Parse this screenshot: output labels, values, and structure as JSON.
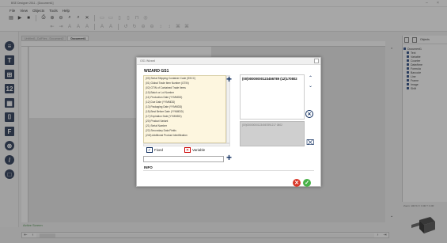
{
  "window": {
    "title": "BSE Designer 2011 - [Document1]"
  },
  "menu": {
    "items": [
      "File",
      "View",
      "Objects",
      "Tools",
      "Help"
    ]
  },
  "tabs": [
    {
      "label": "Untitled1_CalFiles - Document2",
      "active": false
    },
    {
      "label": "Document1",
      "active": true
    }
  ],
  "status": {
    "active_layer": "Active Screen",
    "zoom_line": "Zoom: 100 %      X: 0.00 Y: 0.00"
  },
  "objects_panel": {
    "title": "Objects",
    "tree": [
      "Document1",
      "Text",
      "Variable",
      "Counter",
      "Date/time",
      "Formula",
      "Barcode",
      "Line",
      "Frame",
      "Image",
      "Shift"
    ]
  },
  "dialog": {
    "title": "GS1 Wizard",
    "wizard_title": "WIZARD GS1",
    "ai_list": [
      "(00) Serial Shipping Container Code (SSCC)",
      "(01) Global Trade Item Number (GTIN)",
      "(02) GTIN of Contained Trade Items",
      "(10) Batch or Lot Number",
      "(11) Production Date (YYMMDD)",
      "(12) Due Date (YYMMDD)",
      "(13) Packaging Date (YYMMDD)",
      "(15) Best Before Date (YYMMDD)",
      "(17) Expiration Date (YYMMDD)",
      "(20) Product Variant",
      "(21) Serial Number",
      "(22) Secondary Data Fields",
      "(240) Additional Product Identification"
    ],
    "code_value": "(00)00000000123456789 (12)170802",
    "preview_value": "(00)000000001234567891217 0802",
    "fixed_label": "Fixed",
    "variable_label": "Variable",
    "value_input": "",
    "info_label": "INFO"
  },
  "colors": {
    "accent": "#0b2a5c",
    "list_bg": "#fdf6df",
    "cancel": "#d93a2b",
    "ok": "#49b149"
  }
}
